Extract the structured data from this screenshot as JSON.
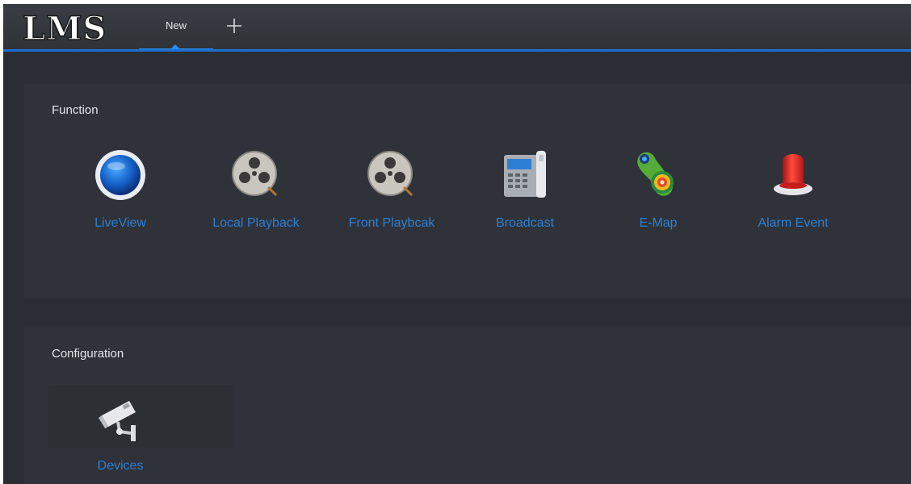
{
  "app": {
    "logo_text": "LMS",
    "tabs": [
      {
        "label": "New",
        "active": true
      }
    ],
    "add_tab_icon": "plus-icon",
    "accent_color": "#1f6fd1"
  },
  "sections": {
    "function": {
      "title": "Function",
      "items": [
        {
          "label": "LiveView",
          "icon": "liveview-icon"
        },
        {
          "label": "Local Playback",
          "icon": "film-reel-icon"
        },
        {
          "label": "Front Playbcak",
          "icon": "film-reel-icon"
        },
        {
          "label": "Broadcast",
          "icon": "broadcast-phone-icon"
        },
        {
          "label": "E-Map",
          "icon": "emap-icon"
        },
        {
          "label": "Alarm Event",
          "icon": "alarm-light-icon"
        }
      ]
    },
    "configuration": {
      "title": "Configuration",
      "items": [
        {
          "label": "Devices",
          "icon": "camera-icon"
        }
      ]
    }
  },
  "label_color": "#2d7fd6"
}
